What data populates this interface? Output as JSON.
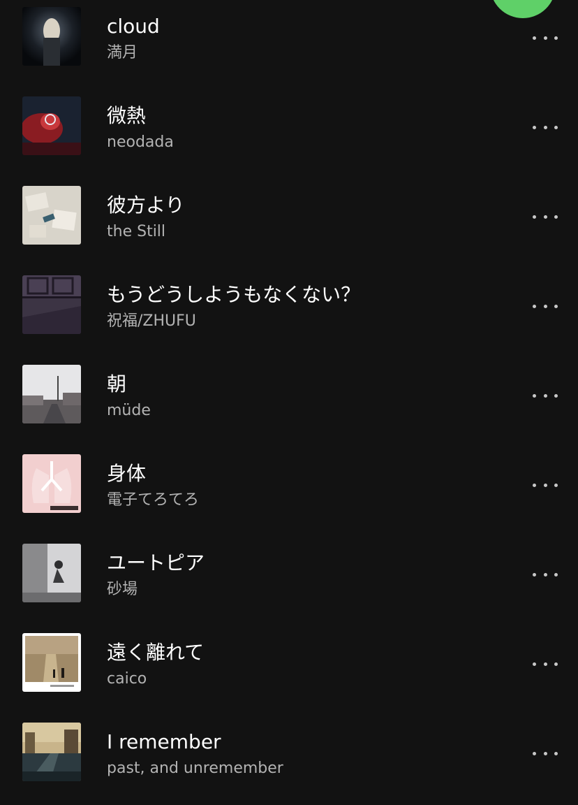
{
  "colors": {
    "background": "#121212",
    "title_text": "#ffffff",
    "artist_text": "#b3b3b3",
    "accent_green": "#5fd068"
  },
  "play_button": {
    "icon": "play-icon"
  },
  "tracks": [
    {
      "title": "cloud",
      "artist": "満月",
      "more_icon": "more-options-icon"
    },
    {
      "title": "微熱",
      "artist": "neodada",
      "more_icon": "more-options-icon"
    },
    {
      "title": "彼方より",
      "artist": "the Still",
      "more_icon": "more-options-icon"
    },
    {
      "title": "もうどうしようもなくない？",
      "artist": "祝福/ZHUFU",
      "more_icon": "more-options-icon"
    },
    {
      "title": "朝",
      "artist": "müde",
      "more_icon": "more-options-icon"
    },
    {
      "title": "身体",
      "artist": "電子てろてろ",
      "more_icon": "more-options-icon"
    },
    {
      "title": "ユートピア",
      "artist": "砂場",
      "more_icon": "more-options-icon"
    },
    {
      "title": "遠く離れて",
      "artist": "caico",
      "more_icon": "more-options-icon"
    },
    {
      "title": "I remember",
      "artist": "past, and unremember",
      "more_icon": "more-options-icon"
    }
  ]
}
